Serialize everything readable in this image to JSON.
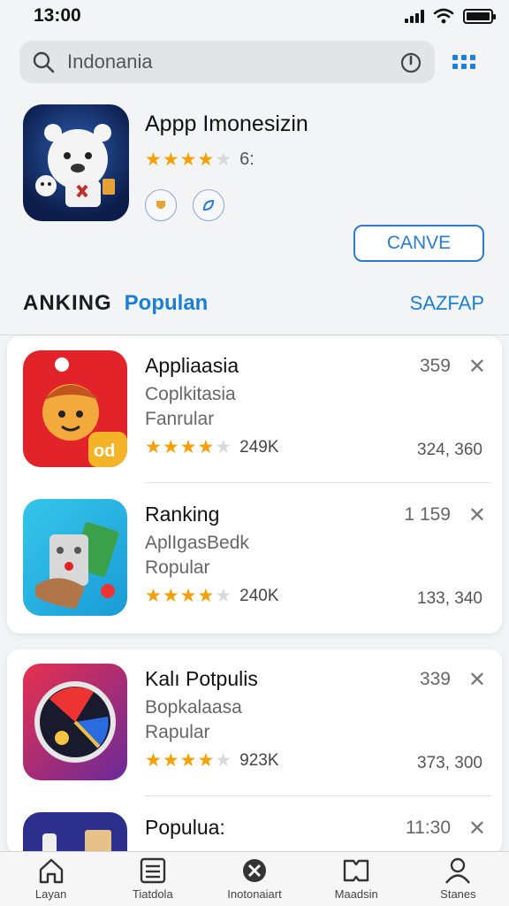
{
  "status": {
    "time": "13:00"
  },
  "search": {
    "query": "Indonania"
  },
  "featured": {
    "title": "Appp Imonesizin",
    "rating_count": "6:",
    "cta_label": "CANVE"
  },
  "section": {
    "title": "ANKING",
    "subtitle": "Populan",
    "link": "SAZFAP"
  },
  "apps": [
    {
      "name": "Appliaasia",
      "line1": "Coplkitasia",
      "line2": "Fanrular",
      "rating_count": "249K",
      "number": "359",
      "meta": "324, 360"
    },
    {
      "name": "Ranking",
      "line1": "AplIgasBedk",
      "line2": "Ropular",
      "rating_count": "240K",
      "number": "1 159",
      "meta": "133, 340"
    },
    {
      "name": "Kalı Potpulis",
      "line1": "Bopkalaasa",
      "line2": "Rapular",
      "rating_count": "923K",
      "number": "339",
      "meta": "373, 300"
    },
    {
      "name": "Populua:",
      "number": "11:30"
    }
  ],
  "tabs": [
    {
      "label": "Layan",
      "icon": "home-icon"
    },
    {
      "label": "Tiatdola",
      "icon": "list-icon"
    },
    {
      "label": "Inotonaiart",
      "icon": "close-circle-icon"
    },
    {
      "label": "Maadsin",
      "icon": "book-icon"
    },
    {
      "label": "Stanes",
      "icon": "person-icon"
    }
  ],
  "colors": {
    "accent": "#1a7fd4",
    "star": "#f5a000",
    "background": "#f3f4f6"
  }
}
